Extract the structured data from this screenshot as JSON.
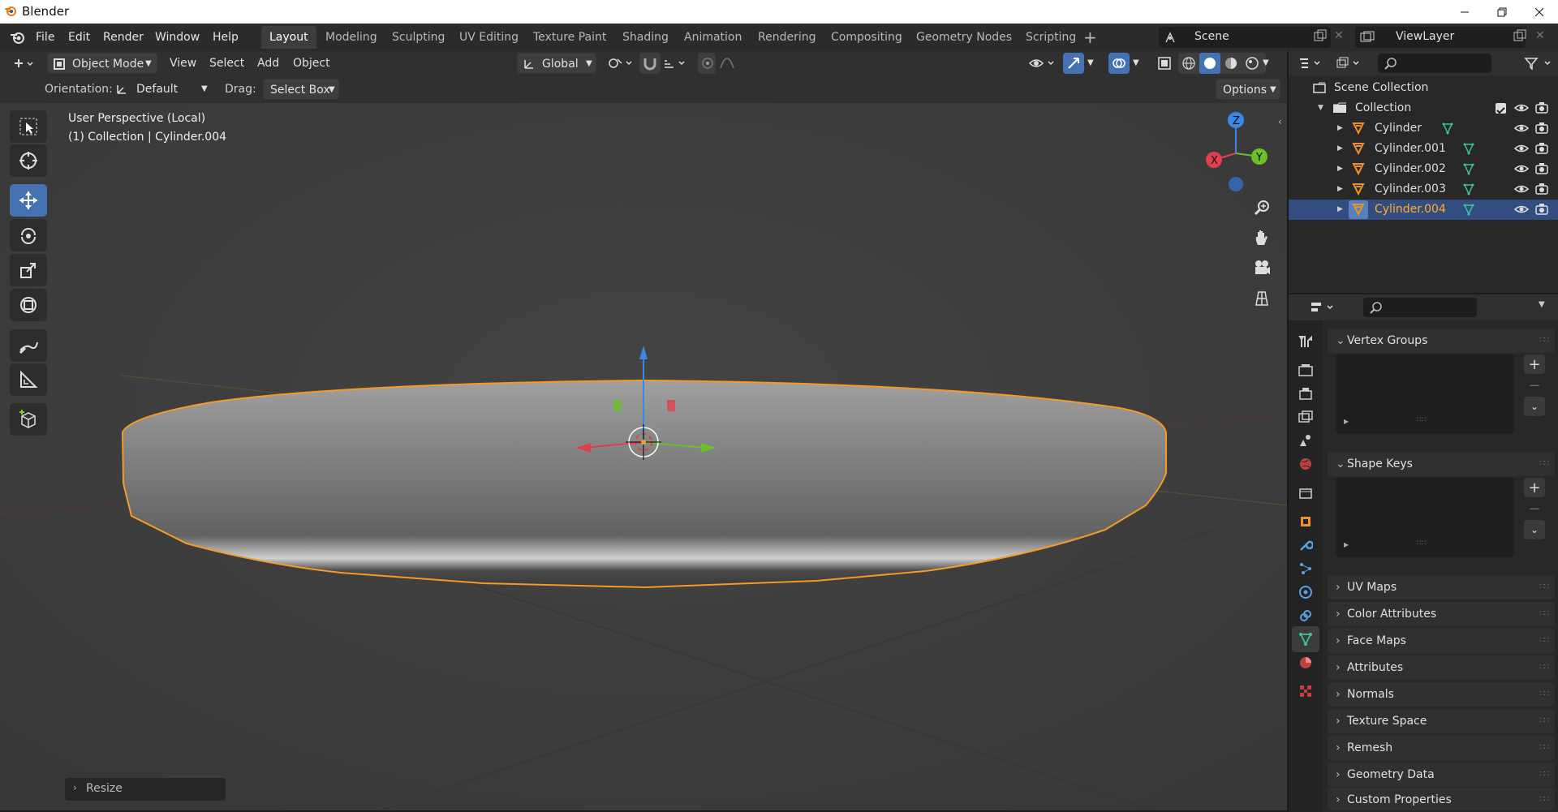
{
  "window": {
    "title": "Blender"
  },
  "menu": [
    "File",
    "Edit",
    "Render",
    "Window",
    "Help"
  ],
  "workspaces": [
    "Layout",
    "Modeling",
    "Sculpting",
    "UV Editing",
    "Texture Paint",
    "Shading",
    "Animation",
    "Rendering",
    "Compositing",
    "Geometry Nodes",
    "Scripting"
  ],
  "scene": {
    "scene_name": "Scene",
    "view_layer": "ViewLayer"
  },
  "viewport_header": {
    "mode": "Object Mode",
    "menus": [
      "View",
      "Select",
      "Add",
      "Object"
    ],
    "transform_orientation": "Global"
  },
  "tool_header": {
    "orientation_label": "Orientation:",
    "orientation_value": "Default",
    "drag_label": "Drag:",
    "drag_value": "Select Box",
    "options_label": "Options"
  },
  "viewport": {
    "perspective_text": "User Perspective (Local)",
    "collection_text": "(1) Collection | Cylinder.004",
    "last_operator": "Resize",
    "axes": {
      "x": "X",
      "y": "Y",
      "z": "Z"
    }
  },
  "outliner": {
    "root": "Scene Collection",
    "collection": "Collection",
    "objects": [
      "Cylinder",
      "Cylinder.001",
      "Cylinder.002",
      "Cylinder.003",
      "Cylinder.004"
    ],
    "selected": "Cylinder.004"
  },
  "properties": {
    "panels": [
      "Vertex Groups",
      "Shape Keys",
      "UV Maps",
      "Color Attributes",
      "Face Maps",
      "Attributes",
      "Normals",
      "Texture Space",
      "Remesh",
      "Geometry Data",
      "Custom Properties"
    ]
  },
  "colors": {
    "accent": "#4472b3",
    "selection_outline": "#f39a2a",
    "selected_row": "#334d80"
  }
}
